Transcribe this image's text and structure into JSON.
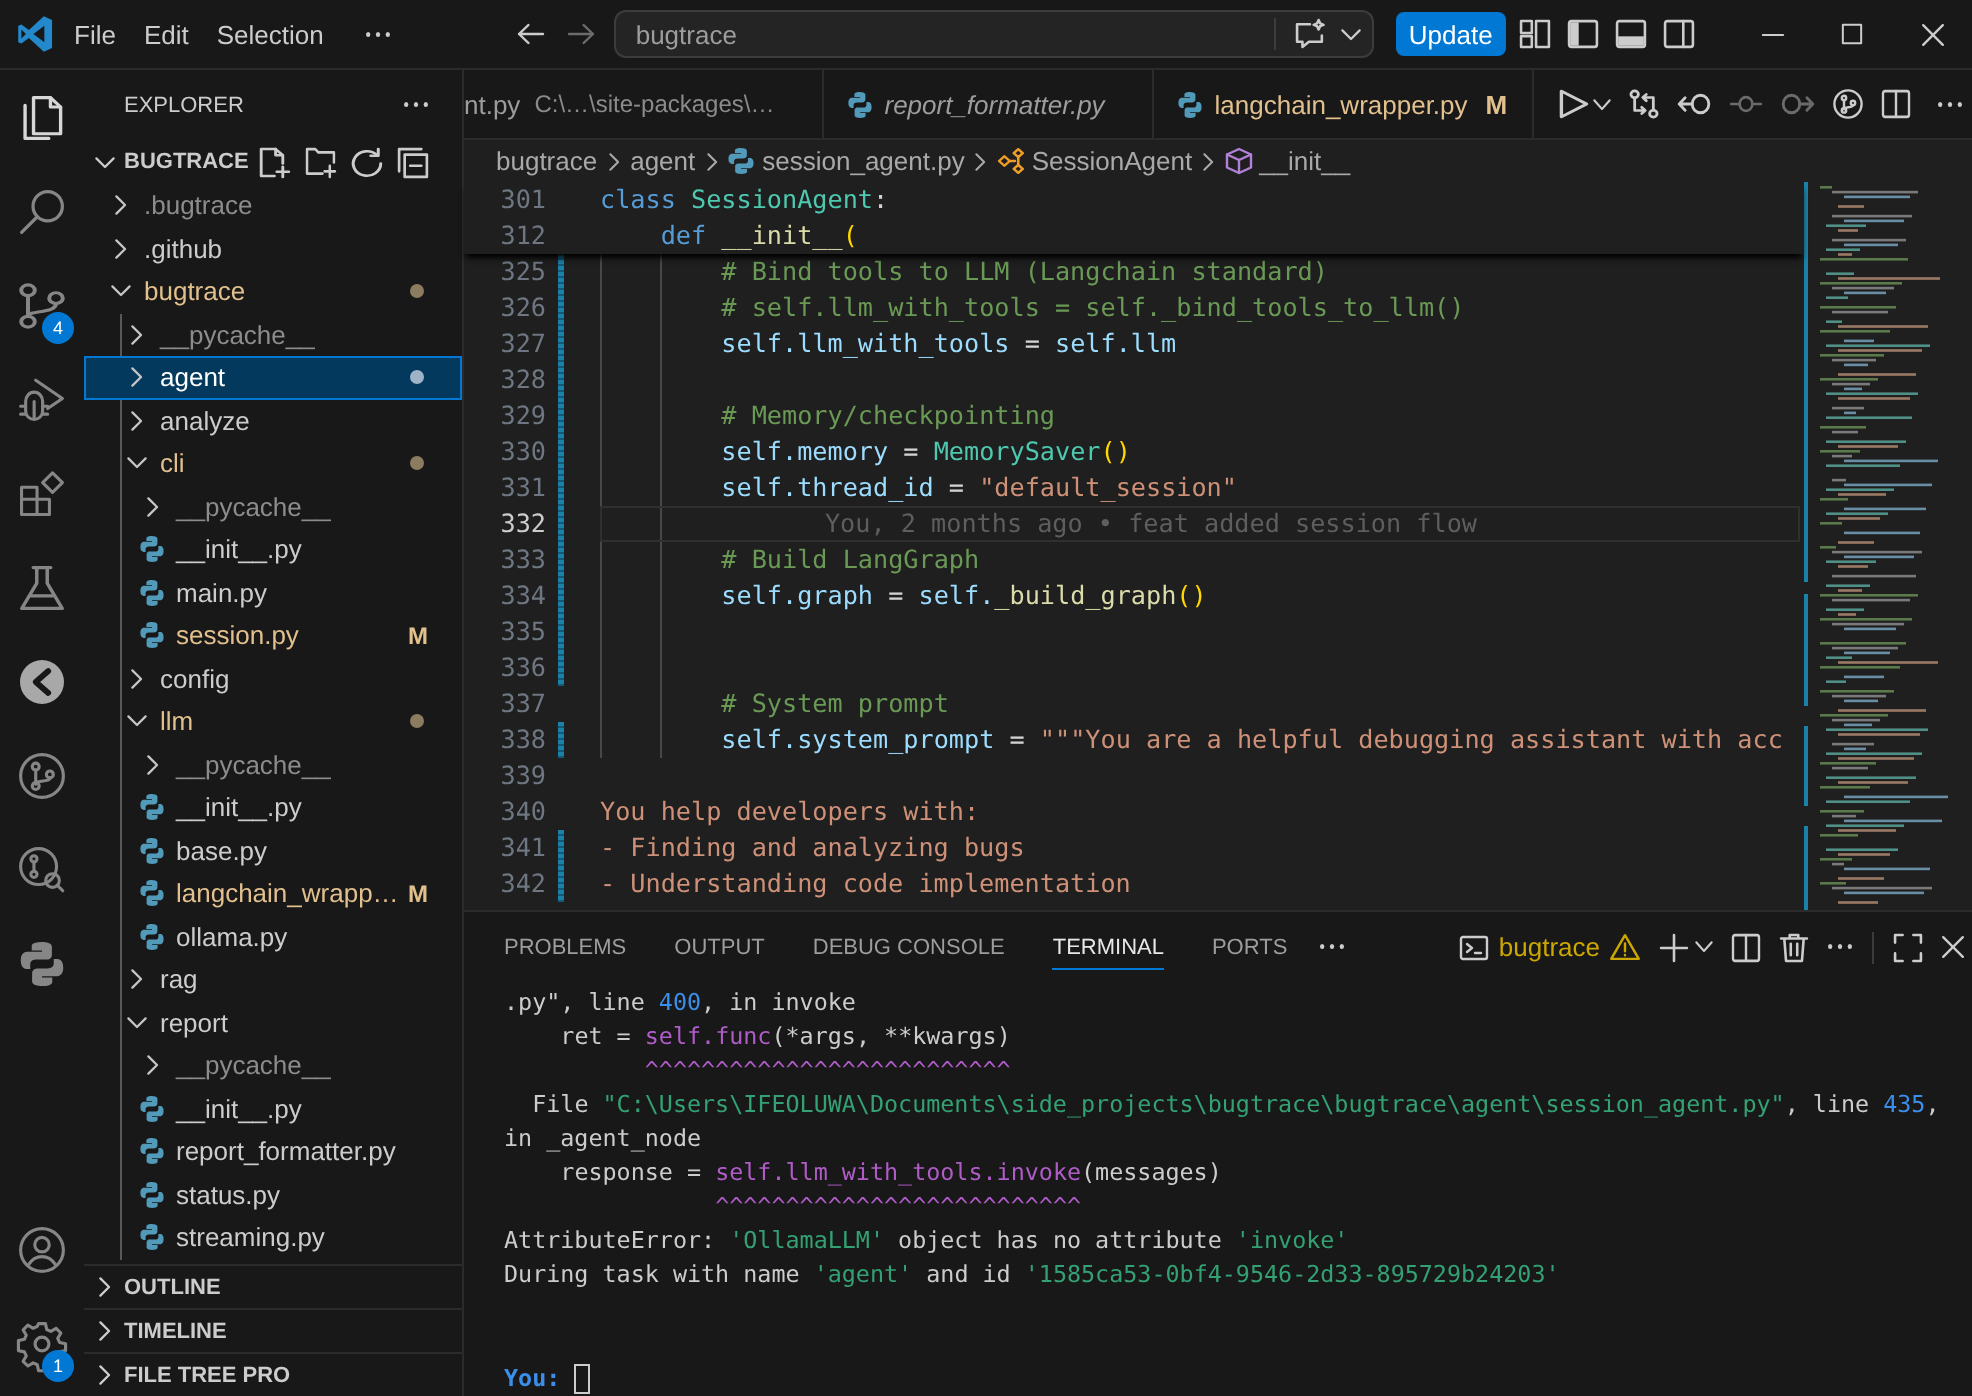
{
  "title_bar": {
    "menu": [
      "File",
      "Edit",
      "Selection"
    ],
    "navigation": [
      {
        "disabled": false
      },
      {
        "disabled": true
      }
    ],
    "command_center": {
      "label": "bugtrace"
    },
    "update_button": "Update"
  },
  "activity_bar": {
    "top": [
      {
        "selected": true
      },
      {
        "selected": false
      },
      {
        "selected": false,
        "badge": "4"
      },
      {
        "selected": false
      },
      {
        "selected": false
      },
      {
        "selected": false
      },
      {
        "selected": false
      },
      {
        "selected": false
      },
      {
        "selected": false
      },
      {
        "selected": false
      }
    ],
    "bottom": [
      {
        "selected": false
      },
      {
        "selected": false,
        "badge": "1"
      }
    ]
  },
  "sidebar": {
    "title": "EXPLORER",
    "workspace": {
      "label": "BUGTRACE",
      "expanded": true
    },
    "tree": [
      {
        "label": ".bugtrace",
        "kind": "folder",
        "expanded": false,
        "selected": false,
        "ignored": true,
        "modified": false
      },
      {
        "label": ".github",
        "kind": "folder",
        "expanded": false,
        "selected": false,
        "ignored": false,
        "modified": false
      },
      {
        "label": "bugtrace",
        "kind": "folder",
        "expanded": true,
        "selected": false,
        "ignored": false,
        "modified": true,
        "children": [
          {
            "label": "__pycache__",
            "kind": "folder",
            "expanded": false,
            "selected": false,
            "ignored": true,
            "modified": false
          },
          {
            "label": "agent",
            "kind": "folder",
            "expanded": false,
            "selected": true,
            "ignored": false,
            "modified": true
          },
          {
            "label": "analyze",
            "kind": "folder",
            "expanded": false,
            "selected": false,
            "ignored": false,
            "modified": false
          },
          {
            "label": "cli",
            "kind": "folder",
            "expanded": true,
            "selected": false,
            "ignored": false,
            "modified": true,
            "children": [
              {
                "label": "__pycache__",
                "kind": "folder",
                "expanded": false,
                "selected": false,
                "ignored": true,
                "modified": false
              },
              {
                "label": "__init__.py",
                "kind": "file",
                "selected": false,
                "ignored": false,
                "modified": false
              },
              {
                "label": "main.py",
                "kind": "file",
                "selected": false,
                "ignored": false,
                "modified": false
              },
              {
                "label": "session.py",
                "kind": "file",
                "selected": false,
                "ignored": false,
                "modified": true,
                "status": "M"
              }
            ]
          },
          {
            "label": "config",
            "kind": "folder",
            "expanded": false,
            "selected": false,
            "ignored": false,
            "modified": false
          },
          {
            "label": "llm",
            "kind": "folder",
            "expanded": true,
            "selected": false,
            "ignored": false,
            "modified": true,
            "children": [
              {
                "label": "__pycache__",
                "kind": "folder",
                "expanded": false,
                "selected": false,
                "ignored": true,
                "modified": false
              },
              {
                "label": "__init__.py",
                "kind": "file",
                "selected": false,
                "ignored": false,
                "modified": false
              },
              {
                "label": "base.py",
                "kind": "file",
                "selected": false,
                "ignored": false,
                "modified": false
              },
              {
                "label": "langchain_wrapp…",
                "kind": "file",
                "selected": false,
                "ignored": false,
                "modified": true,
                "status": "M"
              },
              {
                "label": "ollama.py",
                "kind": "file",
                "selected": false,
                "ignored": false,
                "modified": false
              }
            ]
          },
          {
            "label": "rag",
            "kind": "folder",
            "expanded": false,
            "selected": false,
            "ignored": false,
            "modified": false
          },
          {
            "label": "report",
            "kind": "folder",
            "expanded": true,
            "selected": false,
            "ignored": false,
            "modified": false,
            "children": [
              {
                "label": "__pycache__",
                "kind": "folder",
                "expanded": false,
                "selected": false,
                "ignored": true,
                "modified": false
              },
              {
                "label": "__init__.py",
                "kind": "file",
                "selected": false,
                "ignored": false,
                "modified": false
              },
              {
                "label": "report_formatter.py",
                "kind": "file",
                "selected": false,
                "ignored": false,
                "modified": false
              },
              {
                "label": "status.py",
                "kind": "file",
                "selected": false,
                "ignored": false,
                "modified": false
              },
              {
                "label": "streaming.py",
                "kind": "file",
                "selected": false,
                "ignored": false,
                "modified": false
              }
            ]
          }
        ]
      }
    ],
    "sections": [
      {
        "label": "OUTLINE",
        "expanded": false
      },
      {
        "label": "TIMELINE",
        "expanded": false
      },
      {
        "label": "FILE TREE PRO",
        "expanded": false
      }
    ]
  },
  "editor": {
    "tabs": [
      {
        "label": "nt.py",
        "description": "C:\\…\\site-packages\\…",
        "file_icon": false,
        "preview": false,
        "modified": false,
        "selected": false
      },
      {
        "label": "report_formatter.py",
        "file_icon": true,
        "preview": true,
        "modified": false,
        "selected": false
      },
      {
        "label": "langchain_wrapper.py",
        "file_icon": true,
        "preview": false,
        "modified": true,
        "status": "M",
        "selected": false
      }
    ],
    "actions": [
      {
        "disabled": false
      },
      {
        "disabled": false
      },
      {
        "disabled": false
      },
      {
        "disabled": false
      },
      {
        "disabled": true
      },
      {
        "disabled": true
      },
      {
        "disabled": false
      },
      {
        "disabled": false
      },
      {
        "disabled": false
      }
    ],
    "breadcrumbs": [
      {
        "label": "bugtrace",
        "kind": "folder"
      },
      {
        "label": "agent",
        "kind": "folder"
      },
      {
        "label": "session_agent.py",
        "kind": "file"
      },
      {
        "label": "SessionAgent",
        "kind": "class"
      },
      {
        "label": "__init__",
        "kind": "method"
      }
    ],
    "sticky_lines": [
      {
        "number": "301",
        "tokens": [
          {
            "text": "class",
            "kind": "keyword"
          },
          {
            "text": " SessionAgent",
            "kind": "type"
          },
          {
            "text": ":",
            "kind": "plain"
          }
        ]
      },
      {
        "number": "312",
        "tokens": [
          {
            "text": "    def",
            "kind": "keyword"
          },
          {
            "text": " __init__",
            "kind": "function"
          },
          {
            "text": "(",
            "kind": "bracket"
          }
        ]
      }
    ],
    "lines": [
      {
        "number": "325",
        "modified": true,
        "current": false,
        "tokens": [
          {
            "text": "        # Bind tools to LLM (Langchain standard)",
            "kind": "comment"
          }
        ]
      },
      {
        "number": "326",
        "modified": true,
        "current": false,
        "tokens": [
          {
            "text": "        # self.llm_with_tools = self._bind_tools_to_llm()",
            "kind": "comment"
          }
        ]
      },
      {
        "number": "327",
        "modified": true,
        "current": false,
        "tokens": [
          {
            "text": "        self.llm_with_tools",
            "kind": "variable"
          },
          {
            "text": " = ",
            "kind": "operator"
          },
          {
            "text": "self.llm",
            "kind": "variable"
          }
        ]
      },
      {
        "number": "328",
        "modified": true,
        "current": false
      },
      {
        "number": "329",
        "modified": true,
        "current": false,
        "tokens": [
          {
            "text": "        # Memory/checkpointing",
            "kind": "comment"
          }
        ]
      },
      {
        "number": "330",
        "modified": true,
        "current": false,
        "tokens": [
          {
            "text": "        self.memory",
            "kind": "variable"
          },
          {
            "text": " = ",
            "kind": "operator"
          },
          {
            "text": "MemorySaver",
            "kind": "type"
          },
          {
            "text": "()",
            "kind": "bracket"
          }
        ]
      },
      {
        "number": "331",
        "modified": true,
        "current": false,
        "tokens": [
          {
            "text": "        self.thread_id",
            "kind": "variable"
          },
          {
            "text": " = ",
            "kind": "operator"
          },
          {
            "text": "\"default_session\"",
            "kind": "string"
          }
        ]
      },
      {
        "number": "332",
        "modified": true,
        "current": true,
        "blame": "You, 2 months ago • feat added session flow"
      },
      {
        "number": "333",
        "modified": true,
        "current": false,
        "tokens": [
          {
            "text": "        # Build LangGraph",
            "kind": "comment"
          }
        ]
      },
      {
        "number": "334",
        "modified": true,
        "current": false,
        "tokens": [
          {
            "text": "        self.graph",
            "kind": "variable"
          },
          {
            "text": " = ",
            "kind": "operator"
          },
          {
            "text": "self.",
            "kind": "variable"
          },
          {
            "text": "_build_graph",
            "kind": "function"
          },
          {
            "text": "()",
            "kind": "bracket"
          }
        ]
      },
      {
        "number": "335",
        "modified": true,
        "current": false
      },
      {
        "number": "336",
        "modified": true,
        "current": false
      },
      {
        "number": "337",
        "modified": false,
        "current": false,
        "tokens": [
          {
            "text": "        # System prompt",
            "kind": "comment"
          }
        ]
      },
      {
        "number": "338",
        "modified": true,
        "current": false,
        "tokens": [
          {
            "text": "        self.system_prompt",
            "kind": "variable"
          },
          {
            "text": " = ",
            "kind": "operator"
          },
          {
            "text": "\"\"\"You are a helpful debugging assistant with acc",
            "kind": "string"
          }
        ]
      },
      {
        "number": "339",
        "modified": false,
        "current": false
      },
      {
        "number": "340",
        "modified": false,
        "current": false,
        "tokens": [
          {
            "text": "You help developers with:",
            "kind": "string"
          }
        ]
      },
      {
        "number": "341",
        "modified": true,
        "current": false,
        "tokens": [
          {
            "text": "- Finding and analyzing bugs",
            "kind": "string"
          }
        ]
      },
      {
        "number": "342",
        "modified": true,
        "current": false,
        "tokens": [
          {
            "text": "- Understanding code implementation",
            "kind": "string"
          }
        ]
      }
    ]
  },
  "panel": {
    "tabs": [
      {
        "label": "PROBLEMS",
        "selected": false
      },
      {
        "label": "OUTPUT",
        "selected": false
      },
      {
        "label": "DEBUG CONSOLE",
        "selected": false
      },
      {
        "label": "TERMINAL",
        "selected": true
      },
      {
        "label": "PORTS",
        "selected": false
      }
    ],
    "terminal": {
      "name": "bugtrace",
      "warning": true,
      "lines": [
        {
          "tokens": [
            {
              "text": ".py\", line ",
              "kind": "plain"
            },
            {
              "text": "400",
              "kind": "number"
            },
            {
              "text": ", in invoke",
              "kind": "plain"
            }
          ]
        },
        {
          "tokens": [
            {
              "text": "    ret = ",
              "kind": "plain"
            },
            {
              "text": "self.func",
              "kind": "call"
            },
            {
              "text": "(*args, **kwargs)",
              "kind": "plain"
            }
          ]
        },
        {
          "tokens": [
            {
              "text": "          ^^^^^^^^^^^^^^^^^^^^^^^^^^",
              "kind": "call"
            }
          ]
        },
        {
          "tokens": [
            {
              "text": "  File ",
              "kind": "plain"
            },
            {
              "text": "\"C:\\Users\\IFEOLUWA\\Documents\\side_projects\\bugtrace\\bugtrace\\agent\\session_agent.py\"",
              "kind": "path"
            },
            {
              "text": ", line ",
              "kind": "plain"
            },
            {
              "text": "435",
              "kind": "number"
            },
            {
              "text": ",",
              "kind": "plain"
            }
          ]
        },
        {
          "tokens": [
            {
              "text": "in _agent_node",
              "kind": "plain"
            }
          ]
        },
        {
          "tokens": [
            {
              "text": "    response = ",
              "kind": "plain"
            },
            {
              "text": "self.llm_with_tools.invoke",
              "kind": "call"
            },
            {
              "text": "(messages)",
              "kind": "plain"
            }
          ]
        },
        {
          "tokens": [
            {
              "text": "               ^^^^^^^^^^^^^^^^^^^^^^^^^^",
              "kind": "call"
            }
          ]
        },
        {
          "tokens": [
            {
              "text": "AttributeError: ",
              "kind": "plain"
            },
            {
              "text": "'OllamaLLM'",
              "kind": "string"
            },
            {
              "text": " object has no attribute ",
              "kind": "plain"
            },
            {
              "text": "'invoke'",
              "kind": "string"
            }
          ]
        },
        {
          "tokens": [
            {
              "text": "During task with name ",
              "kind": "plain"
            },
            {
              "text": "'agent'",
              "kind": "string"
            },
            {
              "text": " and id ",
              "kind": "plain"
            },
            {
              "text": "'1585ca53-0bf4-9546-2d33-895729b24203'",
              "kind": "string"
            }
          ]
        }
      ],
      "prompt": "You:"
    }
  }
}
